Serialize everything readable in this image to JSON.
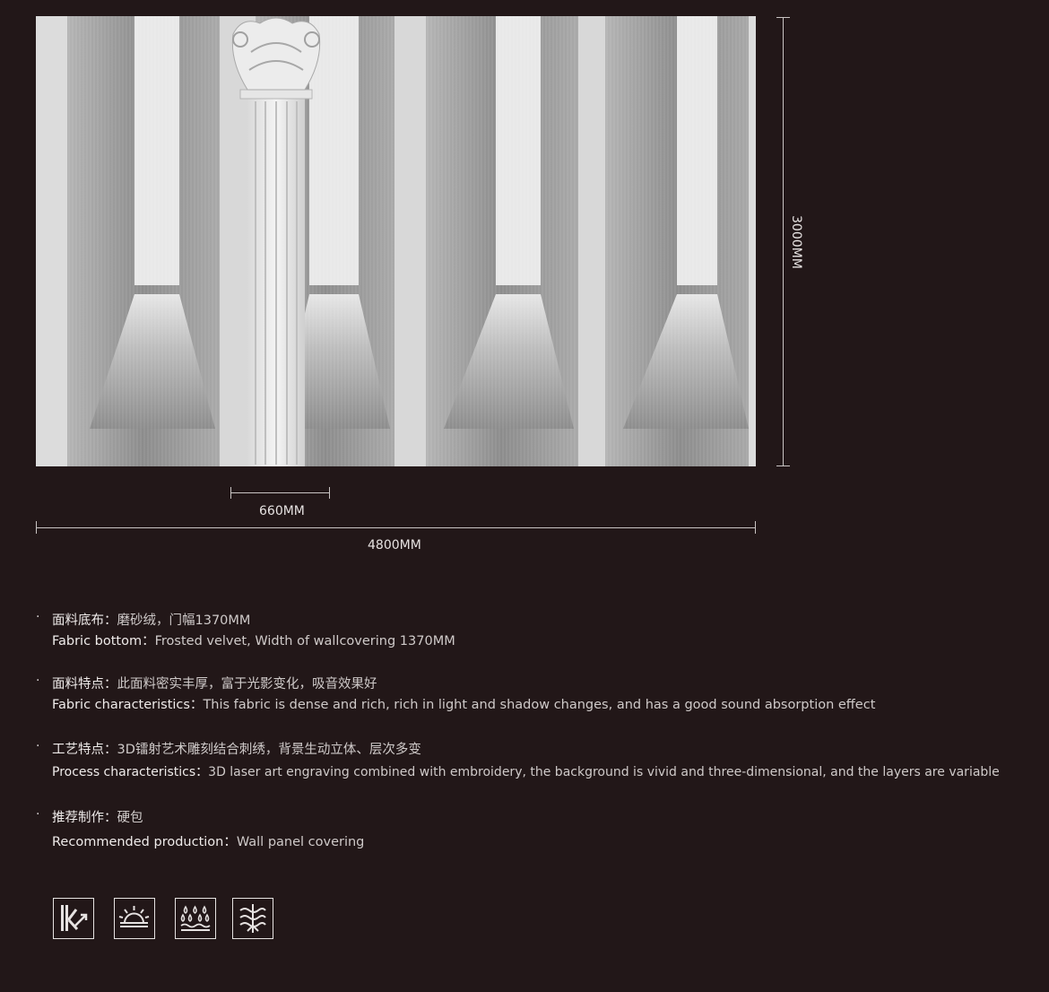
{
  "dimensions": {
    "height_label": "3000MM",
    "door_width_label": "660MM",
    "total_width_label": "4800MM"
  },
  "specs": [
    {
      "cn_key": "面料底布：",
      "cn_value": "磨砂绒，门幅1370MM",
      "en_key": "Fabric bottom：",
      "en_value": "Frosted velvet, Width of wallcovering 1370MM"
    },
    {
      "cn_key": "面料特点：",
      "cn_value": "此面料密实丰厚，富于光影变化，吸音效果好",
      "en_key": "Fabric characteristics：",
      "en_value": "This fabric is dense and rich, rich in light and shadow changes, and has a good sound absorption effect"
    },
    {
      "cn_key": "工艺特点：",
      "cn_value": "3D镭射艺术雕刻结合刺绣，背景生动立体、层次多变",
      "en_key": "Process characteristics：",
      "en_value": "3D laser art engraving combined with embroidery, the background is vivid and three-dimensional, and the layers are variable"
    },
    {
      "cn_key": "推荐制作：",
      "cn_value": "硬包",
      "en_key": "Recommended production：",
      "en_value": "Wall panel covering"
    }
  ],
  "bullet": "·",
  "icons": [
    "light-resistance-icon",
    "sun-fastness-icon",
    "water-resistant-icon",
    "moisture-proof-icon"
  ],
  "colors": {
    "background": "#221718",
    "text": "#d8d3d2"
  }
}
